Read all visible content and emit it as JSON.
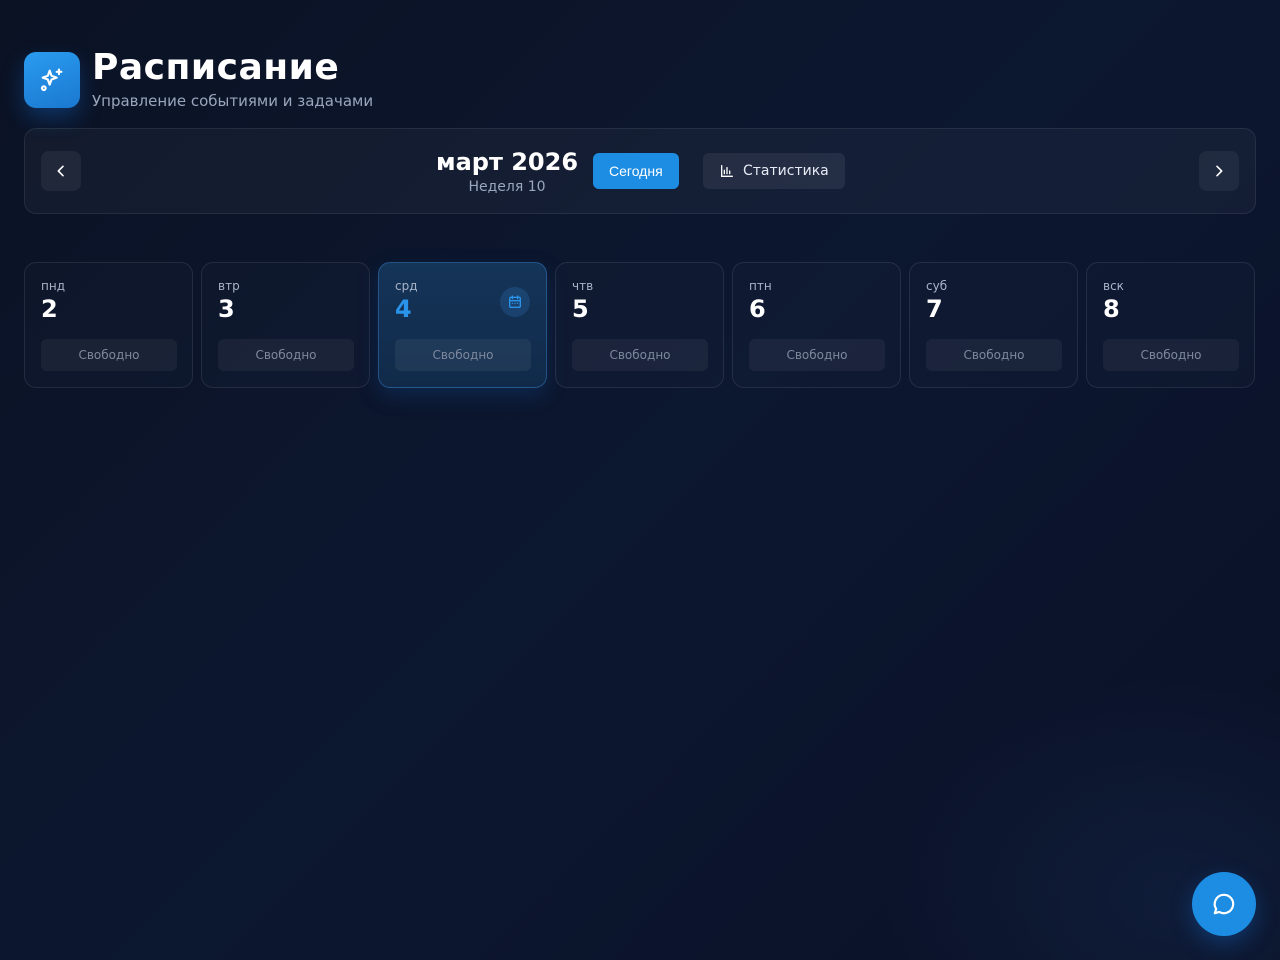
{
  "header": {
    "title": "Расписание",
    "subtitle": "Управление событиями и задачами",
    "logo_icon": "sparkles-icon"
  },
  "nav": {
    "prev_icon": "chevron-left-icon",
    "next_icon": "chevron-right-icon",
    "month_title": "март 2026",
    "week_label": "Неделя 10",
    "today_label": "Сегодня",
    "stats_label": "Статистика",
    "stats_icon": "bar-chart-icon"
  },
  "days": [
    {
      "name": "пнд",
      "num": "2",
      "status": "Свободно",
      "today": false
    },
    {
      "name": "втр",
      "num": "3",
      "status": "Свободно",
      "today": false
    },
    {
      "name": "срд",
      "num": "4",
      "status": "Свободно",
      "today": true
    },
    {
      "name": "чтв",
      "num": "5",
      "status": "Свободно",
      "today": false
    },
    {
      "name": "птн",
      "num": "6",
      "status": "Свободно",
      "today": false
    },
    {
      "name": "суб",
      "num": "7",
      "status": "Свободно",
      "today": false
    },
    {
      "name": "вск",
      "num": "8",
      "status": "Свободно",
      "today": false
    }
  ],
  "colors": {
    "accent": "#1c8de3",
    "today_number": "#2a94ea",
    "background": "#0b1224"
  },
  "fab": {
    "icon": "chat-bubble-icon"
  }
}
